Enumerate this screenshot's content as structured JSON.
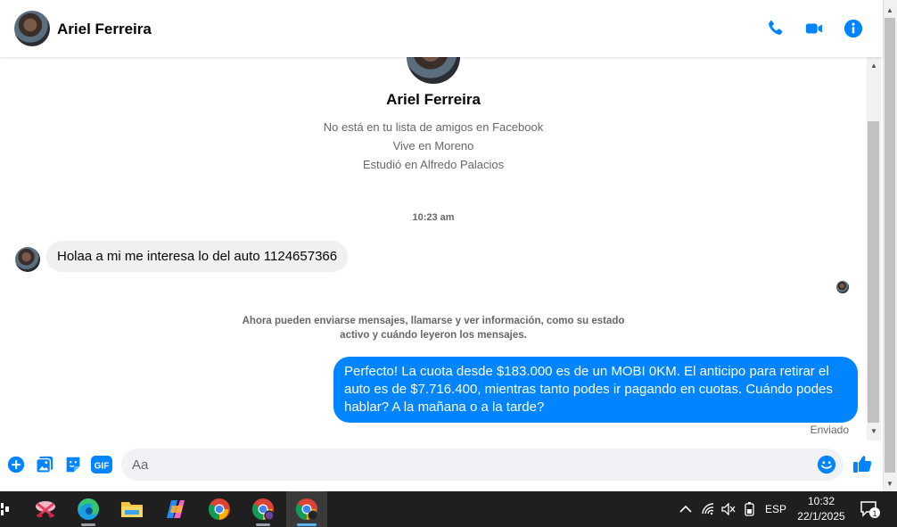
{
  "header": {
    "contact_name": "Ariel Ferreira",
    "icons": [
      "phone-icon",
      "video-camera-icon",
      "info-icon"
    ]
  },
  "profile": {
    "name": "Ariel Ferreira",
    "lines": [
      "No está en tu lista de amigos en Facebook",
      "Vive en Moreno",
      "Estudió en Alfredo Palacios"
    ]
  },
  "chat": {
    "timestamp": "10:23 am",
    "incoming_message": "Holaa a mi me interesa lo del auto 1124657366",
    "notice": "Ahora pueden enviarse mensajes, llamarse y ver información, como su estado activo y cuándo leyeron los mensajes.",
    "outgoing_message": "Perfecto! La cuota desde $183.000 es de un MOBI 0KM. El anticipo para retirar el auto es de $7.716.400, mientras tanto podes ir pagando en cuotas. Cuándo podes hablar? A la mañana o a la tarde?",
    "status": "Enviado"
  },
  "composer": {
    "placeholder": "Aa",
    "icons": [
      "plus-icon",
      "photo-icon",
      "sticker-icon",
      "gif-icon",
      "emoji-icon",
      "thumbs-up-icon"
    ],
    "gif_label": "GIF"
  },
  "taskbar": {
    "apps": [
      "snipping-tool",
      "edge",
      "file-explorer",
      "copilot",
      "chrome",
      "chrome-profile",
      "chrome-profile-active"
    ],
    "language": "ESP",
    "time": "10:32",
    "date": "22/1/2025",
    "notification_count": "1"
  },
  "colors": {
    "accent": "#0084ff",
    "incoming_bubble": "#f0f0f0",
    "taskbar": "#1f1f1f"
  }
}
